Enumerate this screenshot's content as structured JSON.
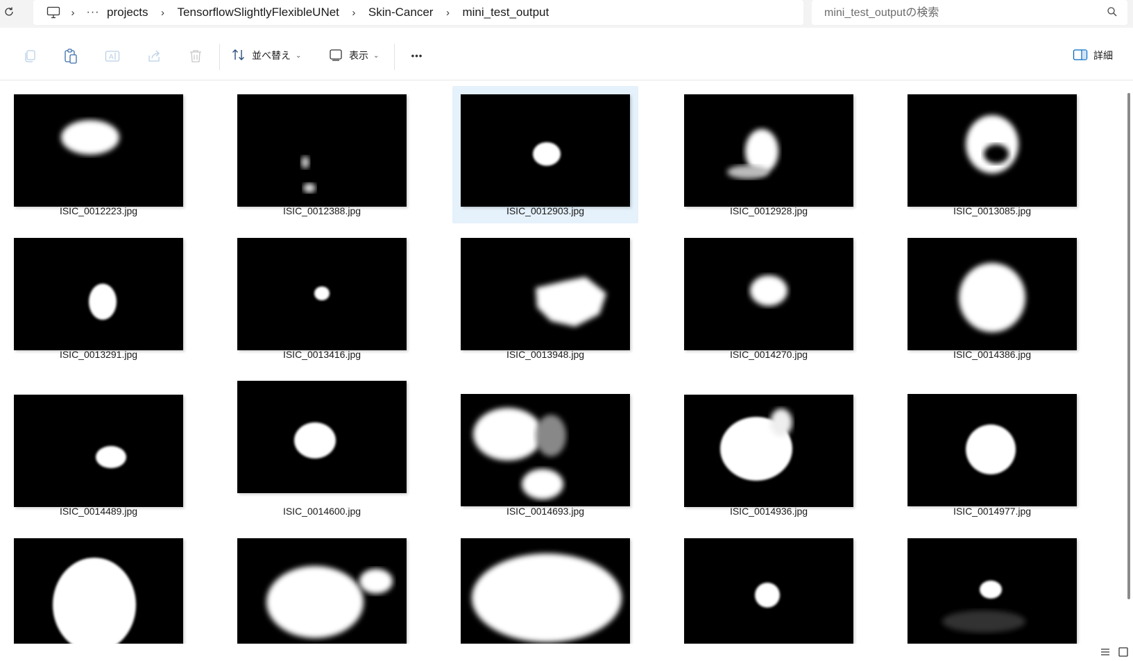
{
  "breadcrumb": {
    "overflow": "···",
    "items": [
      "projects",
      "TensorflowSlightlyFlexibleUNet",
      "Skin-Cancer",
      "mini_test_output"
    ]
  },
  "search": {
    "placeholder": "mini_test_outputの検索"
  },
  "toolbar": {
    "sort_label": "並べ替え",
    "view_label": "表示",
    "more_label": "•••",
    "details_label": "詳細"
  },
  "files": [
    "ISIC_0012223.jpg",
    "ISIC_0012388.jpg",
    "ISIC_0012903.jpg",
    "ISIC_0012928.jpg",
    "ISIC_0013085.jpg",
    "ISIC_0013291.jpg",
    "ISIC_0013416.jpg",
    "ISIC_0013948.jpg",
    "ISIC_0014270.jpg",
    "ISIC_0014386.jpg",
    "ISIC_0014489.jpg",
    "ISIC_0014600.jpg",
    "ISIC_0014693.jpg",
    "ISIC_0014936.jpg",
    "ISIC_0014977.jpg",
    "",
    "",
    "",
    "",
    ""
  ],
  "selected_file": "ISIC_0012903.jpg",
  "colors": {
    "selection": "#e5f1fb",
    "accent": "#0067c0"
  }
}
